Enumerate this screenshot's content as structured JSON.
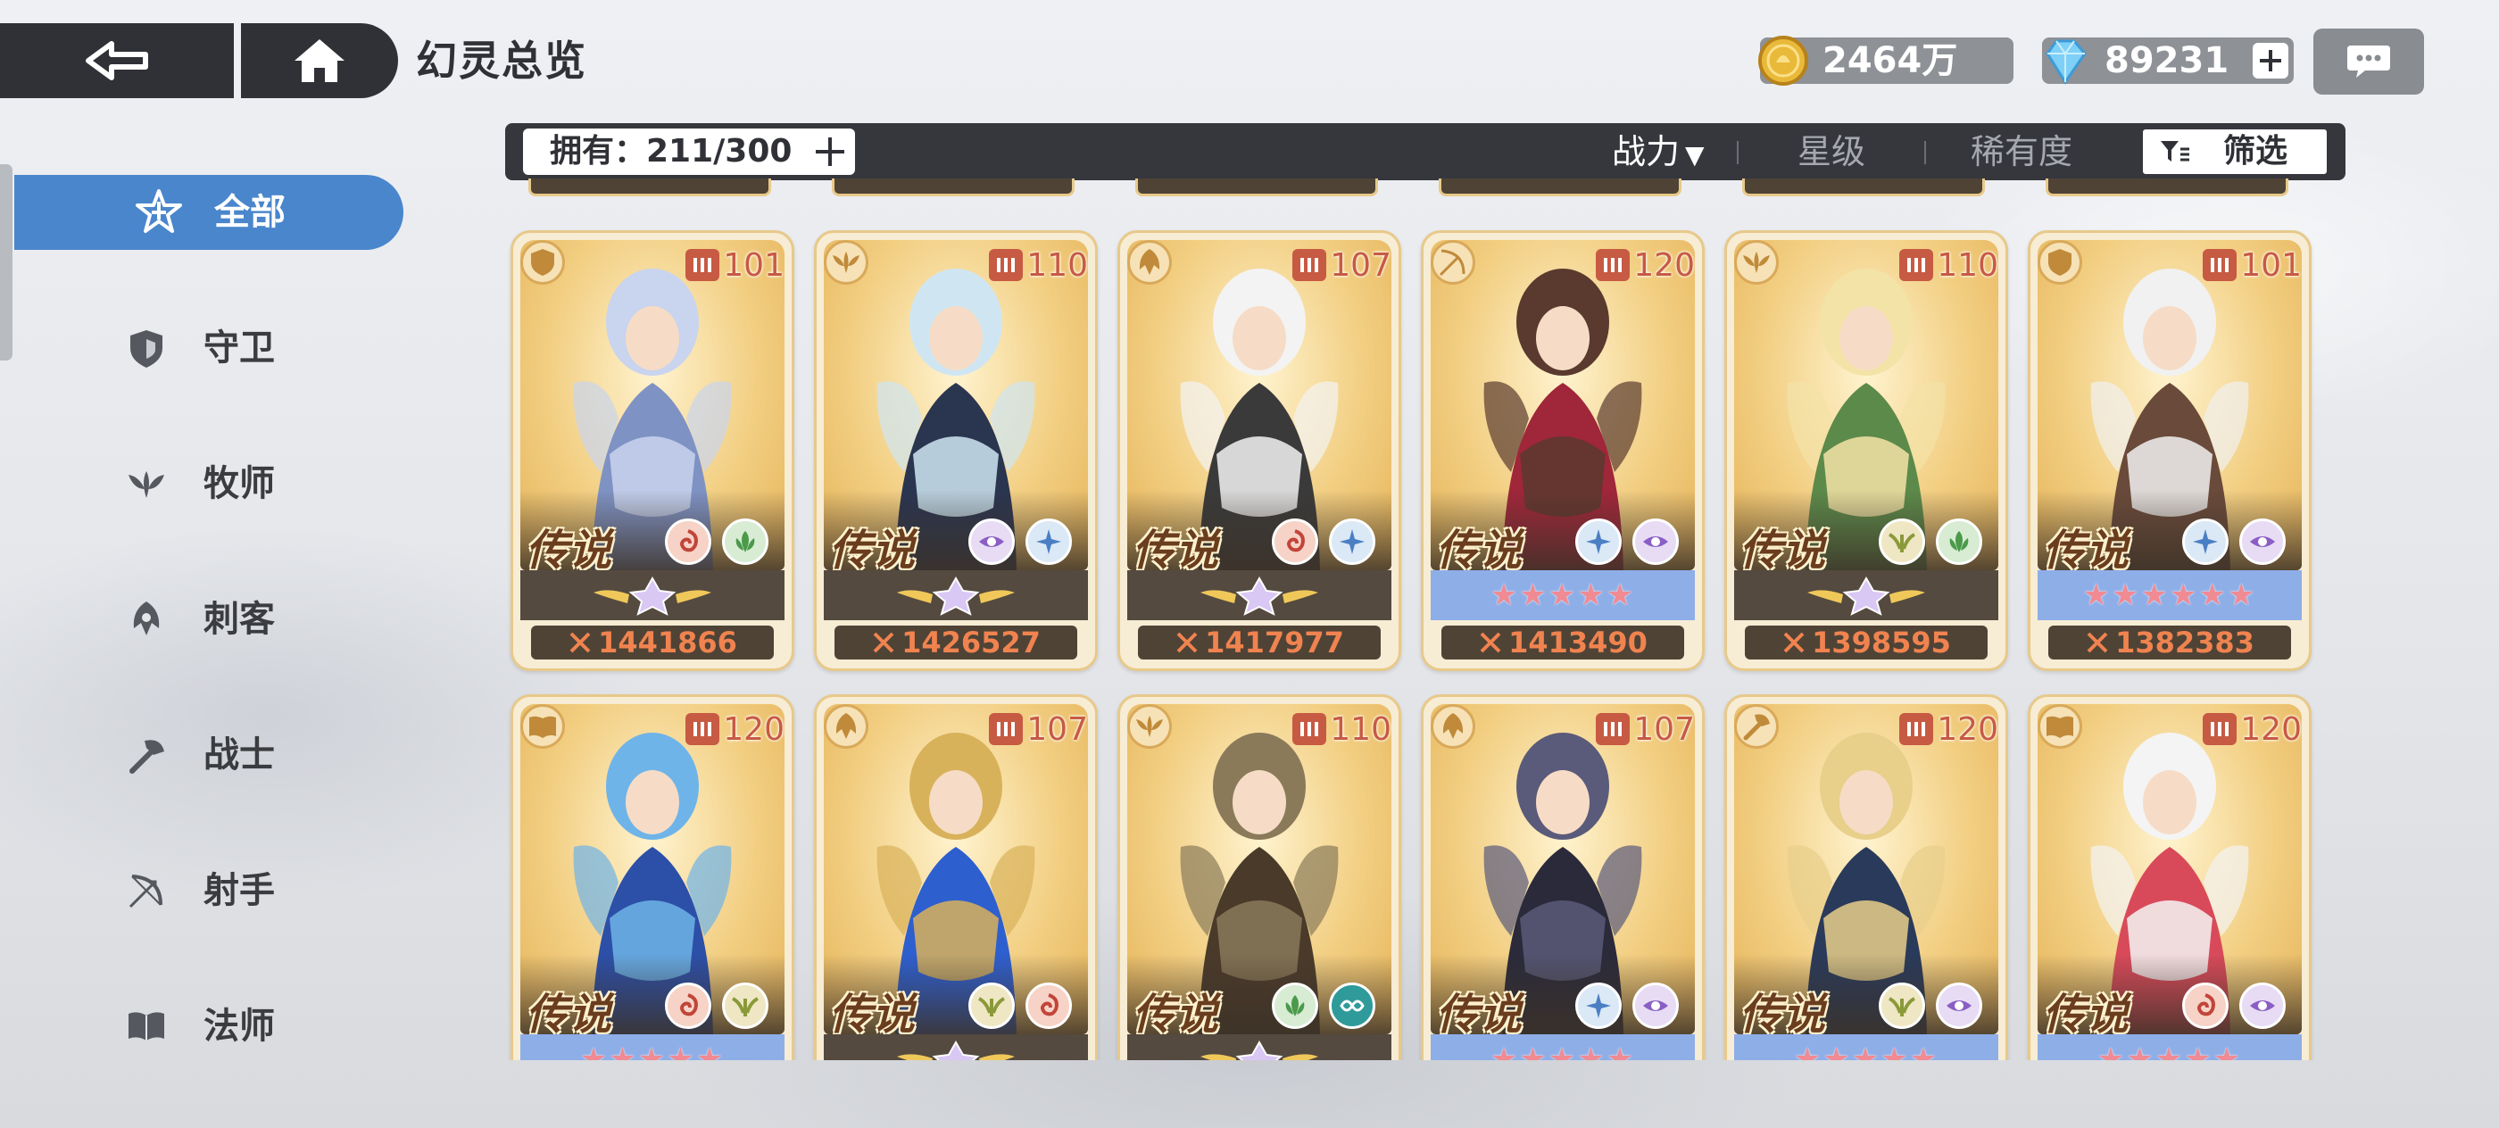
{
  "header": {
    "title": "幻灵总览",
    "gold": "2464万",
    "gems": "89231"
  },
  "filter_bar": {
    "owned_label": "拥有：211/300",
    "sort_power": "战力",
    "sort_star": "星级",
    "sort_rarity": "稀有度",
    "filter": "筛选"
  },
  "sidebar": {
    "items": [
      {
        "label": "全部",
        "icon": "all-star-icon"
      },
      {
        "label": "守卫",
        "icon": "shield-icon"
      },
      {
        "label": "牧师",
        "icon": "leaf-wings-icon"
      },
      {
        "label": "刺客",
        "icon": "assassin-icon"
      },
      {
        "label": "战士",
        "icon": "axe-icon"
      },
      {
        "label": "射手",
        "icon": "bow-icon"
      },
      {
        "label": "法师",
        "icon": "book-icon"
      }
    ]
  },
  "cards": {
    "row1": [
      {
        "level": "101",
        "rarity": "传说",
        "power": "1441866",
        "class_icon": "shield-icon",
        "band": "wings",
        "elements": [
          "fire-swirl",
          "nature"
        ],
        "palette": [
          "#c9d4ee",
          "#7f92c4"
        ]
      },
      {
        "level": "110",
        "rarity": "传说",
        "power": "1426527",
        "class_icon": "leaf-wings-icon",
        "band": "wings",
        "elements": [
          "eye",
          "ice"
        ],
        "palette": [
          "#cfe6f2",
          "#2a3550"
        ]
      },
      {
        "level": "107",
        "rarity": "传说",
        "power": "1417977",
        "class_icon": "assassin-icon",
        "band": "wings",
        "elements": [
          "fire-swirl",
          "ice"
        ],
        "palette": [
          "#f3f3f3",
          "#3a3a3a"
        ]
      },
      {
        "level": "120",
        "rarity": "传说",
        "power": "1413490",
        "class_icon": "bow-icon",
        "band": "stars",
        "stars": "★★★★★",
        "elements": [
          "ice",
          "eye"
        ],
        "palette": [
          "#5a3a2e",
          "#a0263a"
        ]
      },
      {
        "level": "110",
        "rarity": "传说",
        "power": "1398595",
        "class_icon": "leaf-wings-icon",
        "band": "wings",
        "elements": [
          "wings",
          "nature"
        ],
        "palette": [
          "#f4e3a6",
          "#5c8a4a"
        ]
      },
      {
        "level": "101",
        "rarity": "传说",
        "power": "1382383",
        "class_icon": "shield-icon",
        "band": "stars",
        "stars": "★★★★★★",
        "elements": [
          "ice",
          "eye"
        ],
        "palette": [
          "#f1f1f1",
          "#6a4a3a"
        ]
      }
    ],
    "row2": [
      {
        "level": "120",
        "rarity": "传说",
        "class_icon": "book-icon",
        "band": "stars",
        "elements": [
          "fire-swirl",
          "wings"
        ],
        "palette": [
          "#6fb4e8",
          "#2c4fa8"
        ]
      },
      {
        "level": "107",
        "rarity": "传说",
        "class_icon": "assassin-icon",
        "band": "wings",
        "elements": [
          "wings",
          "fire-swirl"
        ],
        "palette": [
          "#d8b25a",
          "#2e5fcf"
        ]
      },
      {
        "level": "110",
        "rarity": "传说",
        "class_icon": "leaf-wings-icon",
        "band": "wings",
        "elements": [
          "nature",
          "infinity"
        ],
        "palette": [
          "#8a7a5a",
          "#4a3a2a"
        ]
      },
      {
        "level": "107",
        "rarity": "传说",
        "class_icon": "assassin-icon",
        "band": "stars",
        "elements": [
          "ice",
          "eye"
        ],
        "palette": [
          "#5a5a7a",
          "#2a2a3a"
        ]
      },
      {
        "level": "120",
        "rarity": "传说",
        "class_icon": "axe-icon",
        "band": "stars",
        "elements": [
          "wings",
          "eye"
        ],
        "palette": [
          "#e8cf8a",
          "#2a3a5a"
        ]
      },
      {
        "level": "120",
        "rarity": "传说",
        "class_icon": "book-icon",
        "band": "stars",
        "elements": [
          "fire-swirl",
          "eye"
        ],
        "palette": [
          "#f4f4f4",
          "#d84a5a"
        ]
      }
    ]
  },
  "colors": {
    "accent_blue": "#4a86cc",
    "dark_bar": "#2f3136",
    "power_orange": "#f0834f",
    "level_red": "#c75a43"
  }
}
